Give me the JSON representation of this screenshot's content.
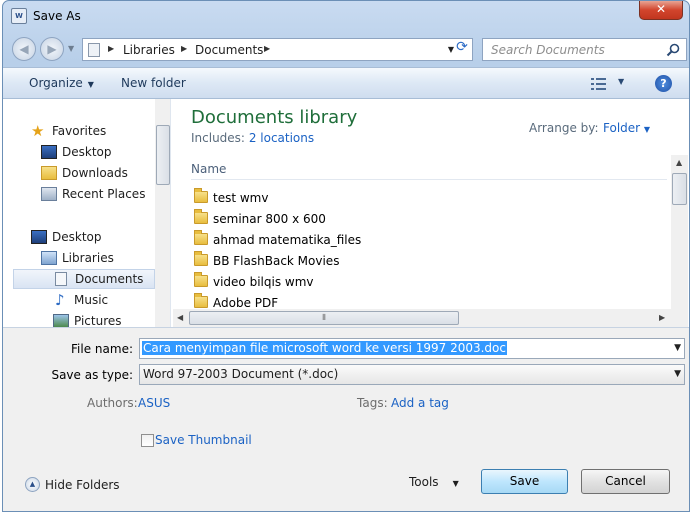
{
  "window": {
    "title": "Save As",
    "close_glyph": "✕",
    "icon_text": "W"
  },
  "address": {
    "back_glyph": "◀",
    "forward_glyph": "▶",
    "parts": [
      "Libraries",
      "Documents"
    ],
    "refresh_glyph": "⟳"
  },
  "search": {
    "placeholder": "Search Documents"
  },
  "toolbar": {
    "organize_label": "Organize",
    "new_folder_label": "New folder",
    "help_glyph": "?"
  },
  "nav": {
    "items": [
      {
        "label": "Favorites",
        "icon": "star-icon"
      },
      {
        "label": "Desktop",
        "icon": "desktop-icon"
      },
      {
        "label": "Downloads",
        "icon": "downloads-icon"
      },
      {
        "label": "Recent Places",
        "icon": "recent-places-icon"
      },
      {
        "label": "Desktop",
        "icon": "desktop-icon"
      },
      {
        "label": "Libraries",
        "icon": "libraries-icon"
      },
      {
        "label": "Documents",
        "icon": "documents-icon",
        "selected": true
      },
      {
        "label": "Music",
        "icon": "music-icon"
      },
      {
        "label": "Pictures",
        "icon": "pictures-icon"
      }
    ]
  },
  "library": {
    "title": "Documents library",
    "includes_label": "Includes:",
    "includes_link": "2 locations",
    "arrange_label": "Arrange by:",
    "arrange_value": "Folder",
    "column_name": "Name",
    "files": [
      "test wmv",
      "seminar 800 x 600",
      "ahmad matematika_files",
      "BB FlashBack Movies",
      "video bilqis wmv",
      "Adobe PDF"
    ]
  },
  "form": {
    "file_name_label": "File name:",
    "file_name_value": "Cara menyimpan file microsoft word ke versi 1997 2003.doc",
    "save_as_type_label": "Save as type:",
    "save_as_type_value": "Word 97-2003 Document (*.doc)",
    "authors_label": "Authors:",
    "authors_value": "ASUS",
    "tags_label": "Tags:",
    "tags_value": "Add a tag",
    "thumbnail_label": "Save Thumbnail"
  },
  "footer": {
    "hide_folders_label": "Hide Folders",
    "tools_label": "Tools",
    "save_label": "Save",
    "cancel_label": "Cancel"
  }
}
